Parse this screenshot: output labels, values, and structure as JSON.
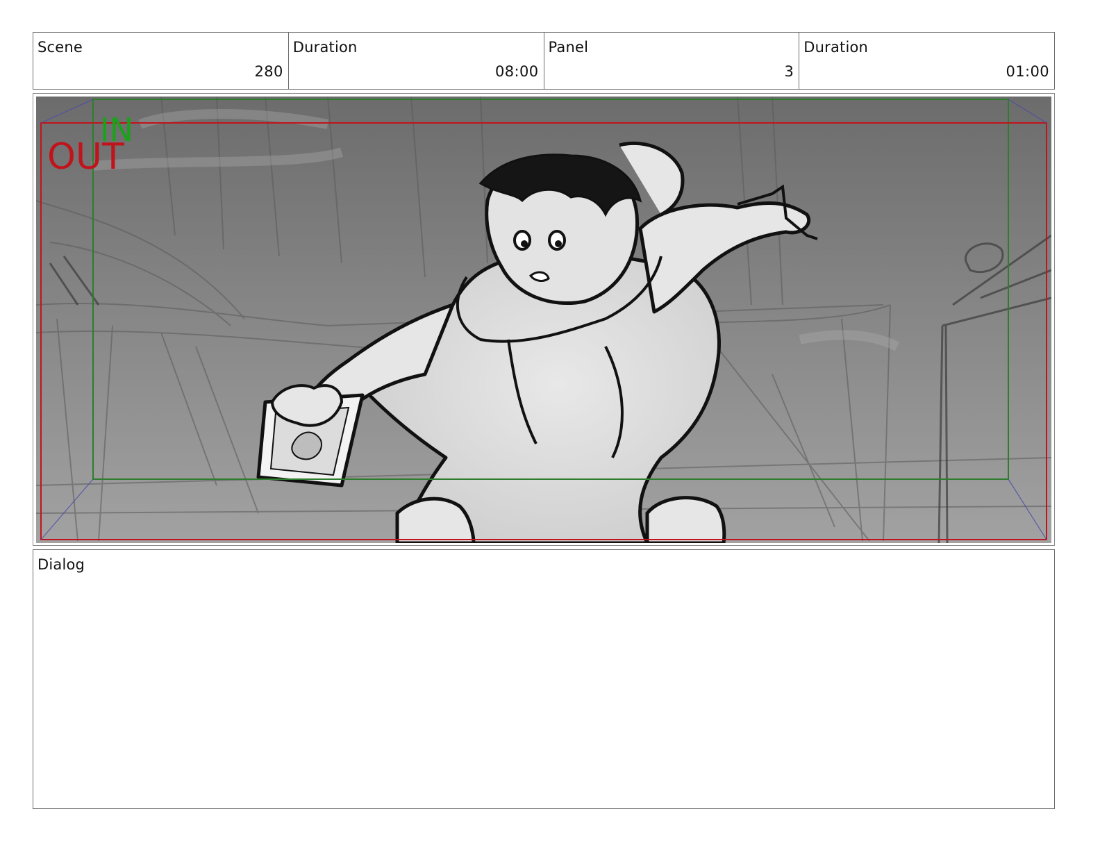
{
  "header": {
    "scene_label": "Scene",
    "scene_value": "280",
    "scene_duration_label": "Duration",
    "scene_duration_value": "08:00",
    "panel_label": "Panel",
    "panel_value": "3",
    "panel_duration_label": "Duration",
    "panel_duration_value": "01:00"
  },
  "panel_image": {
    "in_marker": "IN",
    "out_marker": "OUT",
    "in_color": "#1aa21a",
    "out_color": "#c0141c",
    "frame_in_color": "#2e7d2e",
    "frame_out_color": "#c0141c",
    "description_icon": "storyboard-sketch-character-holding-photo"
  },
  "dialog": {
    "label": "Dialog",
    "text": ""
  }
}
